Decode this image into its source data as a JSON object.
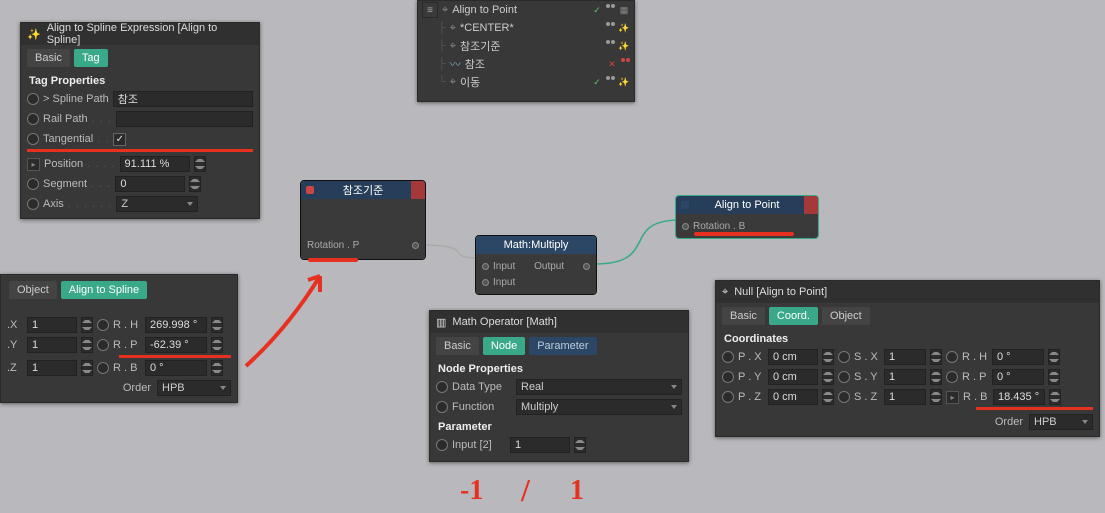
{
  "align_spline_panel": {
    "title": "Align to Spline Expression [Align to Spline]",
    "tabs": {
      "basic": "Basic",
      "tag": "Tag"
    },
    "section": "Tag Properties",
    "spline_path_label": "> Spline Path",
    "spline_path_value": "참조",
    "rail_path_label": "Rail Path",
    "tangential_label": "Tangential",
    "position_label": "Position",
    "position_value": "91.111 %",
    "segment_label": "Segment",
    "segment_value": "0",
    "axis_label": "Axis",
    "axis_value": "Z"
  },
  "coord_left": {
    "tabs": {
      "object": "Object",
      "align": "Align to Spline"
    },
    "rows": [
      {
        "l": ".X",
        "lv": "1",
        "r": "R . H",
        "rv": "269.998 °"
      },
      {
        "l": ".Y",
        "lv": "1",
        "r": "R . P",
        "rv": "-62.39 °"
      },
      {
        "l": ".Z",
        "lv": "1",
        "r": "R . B",
        "rv": "0 °"
      }
    ],
    "order_label": "Order",
    "order_value": "HPB"
  },
  "tree": {
    "title": "Align to Point",
    "items": [
      {
        "label": "*CENTER*",
        "icon": "null"
      },
      {
        "label": "참조기준",
        "icon": "null"
      },
      {
        "label": "참조",
        "icon": "spline"
      },
      {
        "label": "이동",
        "icon": "null"
      }
    ]
  },
  "nodes": {
    "ref": {
      "title": "참조기준",
      "port": "Rotation . P"
    },
    "mult": {
      "title": "Math:Multiply",
      "in1": "Input",
      "in2": "Input",
      "out": "Output"
    },
    "align": {
      "title": "Align to Point",
      "port": "Rotation . B"
    }
  },
  "math_panel": {
    "title": "Math Operator [Math]",
    "tabs": {
      "basic": "Basic",
      "node": "Node",
      "parameter": "Parameter"
    },
    "section1": "Node Properties",
    "datatype_label": "Data Type",
    "datatype_value": "Real",
    "function_label": "Function",
    "function_value": "Multiply",
    "section2": "Parameter",
    "input2_label": "Input [2]",
    "input2_value": "1"
  },
  "null_panel": {
    "title": "Null [Align to Point]",
    "tabs": {
      "basic": "Basic",
      "coord": "Coord.",
      "object": "Object"
    },
    "section": "Coordinates",
    "rows": [
      {
        "p": "P . X",
        "pv": "0 cm",
        "s": "S . X",
        "sv": "1",
        "r": "R . H",
        "rv": "0 °"
      },
      {
        "p": "P . Y",
        "pv": "0 cm",
        "s": "S . Y",
        "sv": "1",
        "r": "R . P",
        "rv": "0 °"
      },
      {
        "p": "P . Z",
        "pv": "0 cm",
        "s": "S . Z",
        "sv": "1",
        "r": "R . B",
        "rv": "18.435 °"
      }
    ],
    "order_label": "Order",
    "order_value": "HPB"
  },
  "hand": {
    "neg1": "-1",
    "slash": "/",
    "pos1": "1"
  }
}
